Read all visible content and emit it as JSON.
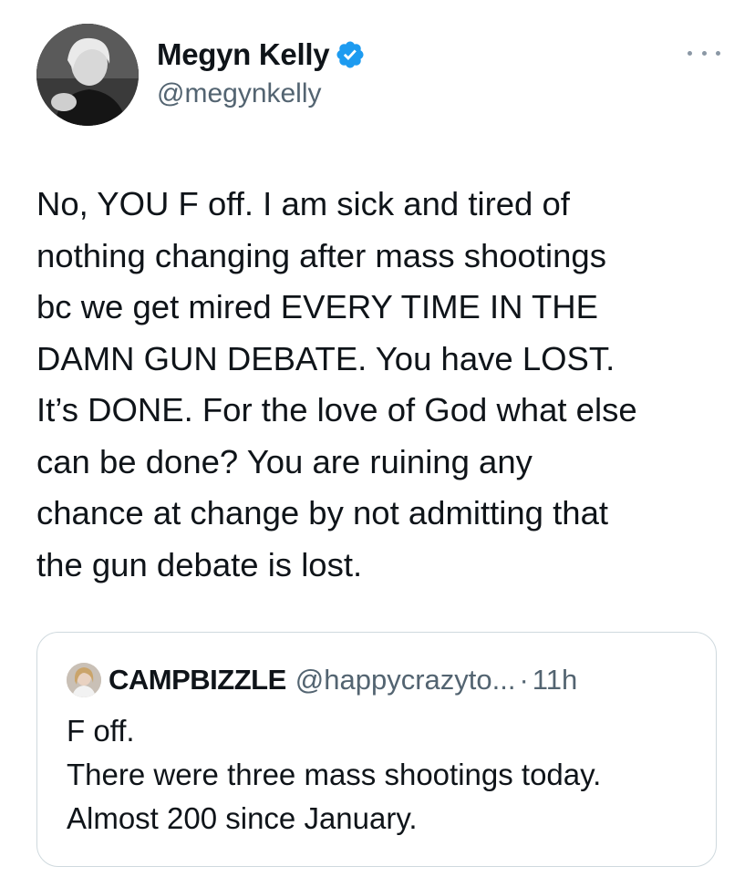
{
  "tweet": {
    "author": {
      "display_name": "Megyn Kelly",
      "handle": "@megynkelly",
      "verified": true
    },
    "icons": {
      "verified": "verified-badge-icon",
      "more": "more-options-icon"
    },
    "text": "No, YOU F off. I am sick and tired of\nnothing changing after mass shootings\nbc we get mired EVERY TIME IN THE\nDAMN GUN DEBATE. You have LOST.\nIt’s DONE. For the love of God what else\ncan be done? You are ruining any\nchance at change by not admitting that\nthe gun debate is lost.",
    "quoted": {
      "display_name": "CAMPBIZZLE",
      "handle": "@happycrazyto...",
      "separator": "·",
      "time": "11h",
      "text": "F off.\nThere were three mass shootings today.\nAlmost 200 since January."
    }
  },
  "colors": {
    "text": "#0f1419",
    "secondary": "#536471",
    "verified": "#1d9bf0",
    "border": "#cfd9de"
  }
}
